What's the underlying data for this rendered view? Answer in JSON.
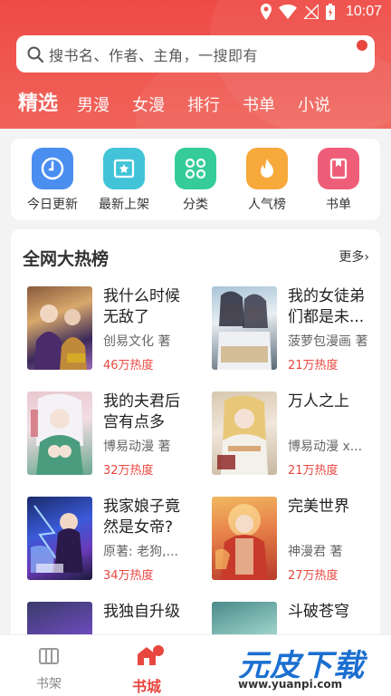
{
  "status_bar": {
    "time": "10:07"
  },
  "search": {
    "placeholder": "搜书名、作者、主角，一搜即有"
  },
  "tabs": [
    {
      "label": "精选",
      "active": true
    },
    {
      "label": "男漫"
    },
    {
      "label": "女漫"
    },
    {
      "label": "排行"
    },
    {
      "label": "书单"
    },
    {
      "label": "小说"
    }
  ],
  "nav": [
    {
      "label": "今日更新",
      "icon": "clock-icon",
      "color": "#4a8ef0"
    },
    {
      "label": "最新上架",
      "icon": "star-box-icon",
      "color": "#42c3d8"
    },
    {
      "label": "分类",
      "icon": "grid-icon",
      "color": "#35cc9a"
    },
    {
      "label": "人气榜",
      "icon": "flame-icon",
      "color": "#f7a93c"
    },
    {
      "label": "书单",
      "icon": "bookmark-book-icon",
      "color": "#ef5e78"
    }
  ],
  "ranking": {
    "title": "全网大热榜",
    "more": "更多",
    "books": [
      {
        "title": "我什么时候无敌了",
        "author": "创易文化 著",
        "heat": "46万热度"
      },
      {
        "title": "我的女徒弟们都是未...",
        "author": "菠萝包漫画 著",
        "heat": "21万热度"
      },
      {
        "title": "我的夫君后宫有点多",
        "author": "博易动漫 著",
        "heat": "32万热度"
      },
      {
        "title": "万人之上",
        "author": "博易动漫 x...",
        "heat": "21万热度"
      },
      {
        "title": "我家娘子竟然是女帝?",
        "author": "原著: 老狗,...",
        "heat": "34万热度"
      },
      {
        "title": "完美世界",
        "author": "神漫君 著",
        "heat": "27万热度"
      },
      {
        "title": "我独自升级",
        "author": "",
        "heat": ""
      },
      {
        "title": "斗破苍穹",
        "author": "",
        "heat": ""
      }
    ]
  },
  "tabbar": [
    {
      "label": "书架",
      "icon": "bookshelf-icon"
    },
    {
      "label": "书城",
      "icon": "store-icon",
      "active": true
    }
  ],
  "watermark": {
    "main": "元皮下载",
    "url": "www.yuanpi.com"
  },
  "colors": {
    "brand_red": "#e8473f",
    "heat_red": "#e8473f"
  }
}
